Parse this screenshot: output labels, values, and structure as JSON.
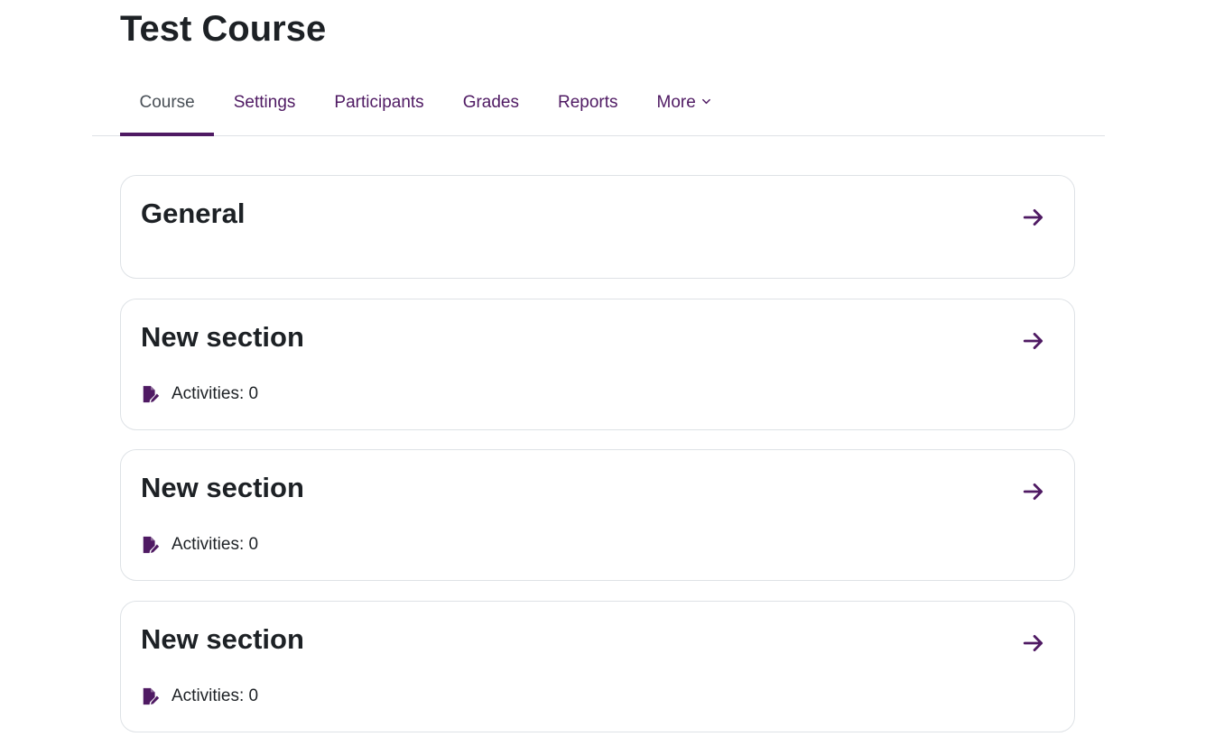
{
  "page": {
    "title": "Test Course"
  },
  "nav": {
    "tabs": [
      {
        "label": "Course",
        "active": true
      },
      {
        "label": "Settings",
        "active": false
      },
      {
        "label": "Participants",
        "active": false
      },
      {
        "label": "Grades",
        "active": false
      },
      {
        "label": "Reports",
        "active": false
      },
      {
        "label": "More",
        "active": false,
        "icon": "chevron-down-icon"
      }
    ]
  },
  "sections": [
    {
      "title": "General",
      "icon": "arrow-right-icon"
    },
    {
      "title": "New section",
      "activities_label": "Activities: 0",
      "icon": "arrow-right-icon",
      "activity_icon": "file-pen-icon"
    },
    {
      "title": "New section",
      "activities_label": "Activities: 0",
      "icon": "arrow-right-icon",
      "activity_icon": "file-pen-icon"
    },
    {
      "title": "New section",
      "activities_label": "Activities: 0",
      "icon": "arrow-right-icon",
      "activity_icon": "file-pen-icon"
    }
  ],
  "colors": {
    "brand": "#4f1a63",
    "text": "#1d2125",
    "muted_tab": "#495057",
    "border": "#dee2e6"
  }
}
